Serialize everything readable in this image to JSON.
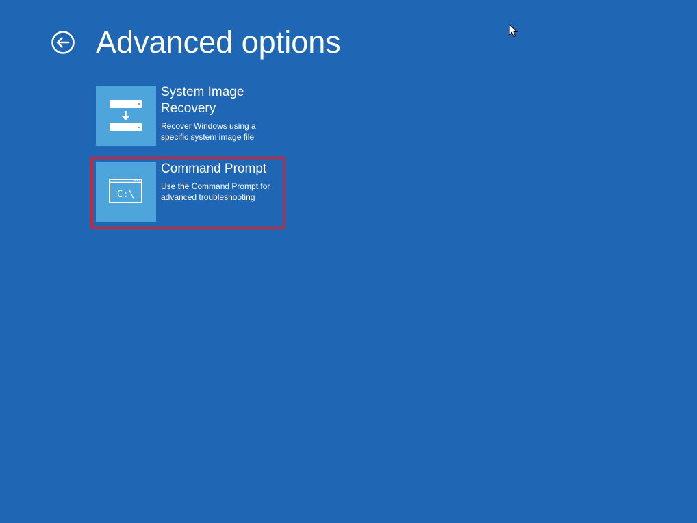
{
  "page": {
    "title": "Advanced options",
    "background_color": "#1f66b4",
    "tile_color": "#4ea5dc",
    "highlight_color": "#e01e2a"
  },
  "back": {
    "icon": "back-arrow-circle-icon"
  },
  "options": [
    {
      "title": "System Image Recovery",
      "description": "Recover Windows using a specific system image file",
      "icon": "drive-restore-icon"
    },
    {
      "title": "Command Prompt",
      "description": "Use the Command Prompt for advanced troubleshooting",
      "icon": "command-prompt-icon",
      "icon_text": "C:\\"
    }
  ],
  "cursor": {
    "icon": "mouse-pointer-icon"
  }
}
